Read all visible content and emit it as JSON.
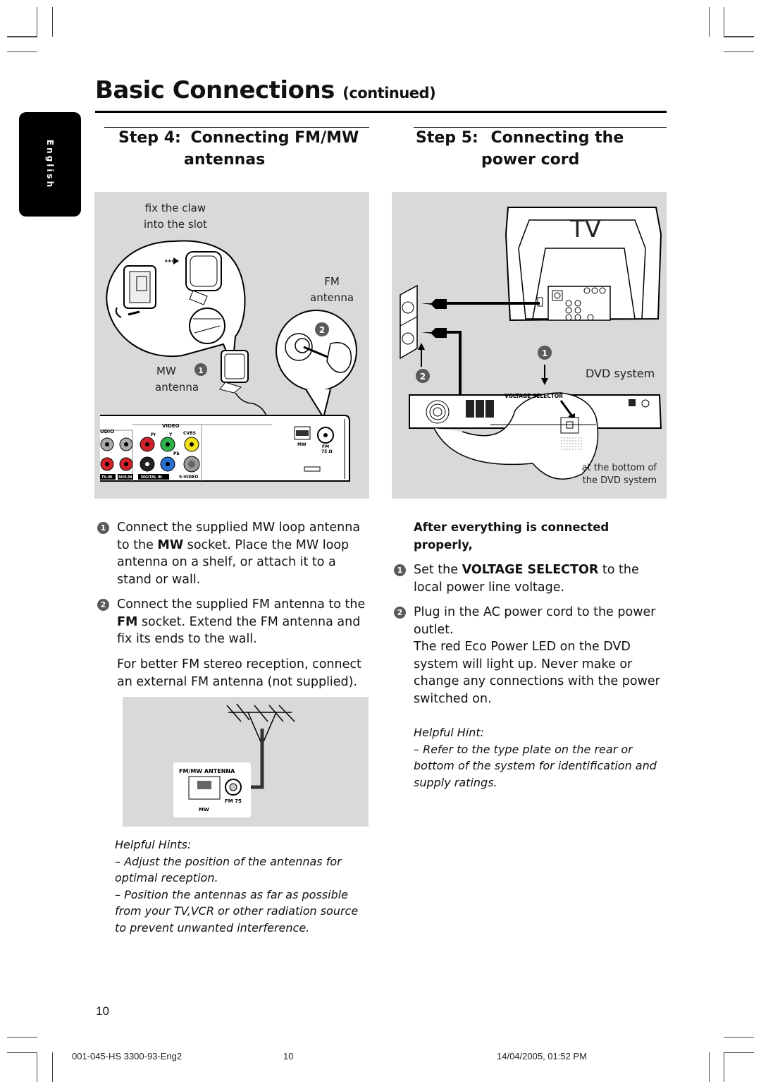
{
  "page": {
    "title": "Basic Connections",
    "title_suffix": "(continued)",
    "language_tab": "English",
    "page_number": "10"
  },
  "step4": {
    "label": "Step 4:",
    "heading_line1": "Connecting FM/MW",
    "heading_line2": "antennas",
    "diagram": {
      "claw_caption_line1": "fix the claw",
      "claw_caption_line2": "into the slot",
      "fm_label": "FM",
      "fm_sub": "antenna",
      "mw_label": "MW",
      "mw_sub": "antenna",
      "badge_1": "1",
      "badge_2": "2",
      "panel_labels": {
        "audio": "UDIO",
        "video": "VIDEO",
        "pr": "Pr",
        "y": "Y",
        "pb": "Pb",
        "cvbs": "CVBS",
        "tv_in": "TV-IN",
        "aux_in": "AUX-IN",
        "digital_in": "DIGITAL IN",
        "s_video": "S-VIDEO",
        "mw": "MW",
        "fm": "FM",
        "fm_ohm": "75 Ω"
      }
    },
    "items": [
      {
        "badge": "1",
        "parts": [
          "Connect the supplied MW loop antenna to the ",
          "MW",
          " socket.  Place the MW loop antenna on a shelf, or attach it to a stand or wall."
        ]
      },
      {
        "badge": "2",
        "parts": [
          "Connect the supplied FM antenna to the ",
          "FM",
          " socket.  Extend the FM antenna and fix its ends to the wall."
        ]
      }
    ],
    "note": "For better FM stereo reception, connect an external FM antenna (not supplied).",
    "ext_diagram": {
      "panel_title": "FM/MW ANTENNA",
      "mw": "MW",
      "fm": "FM  75"
    },
    "hints_title": "Helpful Hints:",
    "hints": [
      "–  Adjust the position of the antennas for optimal reception.",
      "–  Position the antennas as far as possible from your TV,VCR or other radiation source to prevent unwanted interference."
    ]
  },
  "step5": {
    "label": "Step 5:",
    "heading_line1": "Connecting the",
    "heading_line2": "power cord",
    "diagram": {
      "tv_label": "TV",
      "dvd_label": "DVD system",
      "voltage_selector": "VOLTAGE SELECTOR",
      "bottom_caption_line1": "at the bottom of",
      "bottom_caption_line2": "the DVD system",
      "badge_1": "1",
      "badge_2": "2"
    },
    "subheading": "After everything is connected properly,",
    "items": [
      {
        "badge": "1",
        "parts": [
          "Set the ",
          "VOLTAGE SELECTOR",
          " to the local power line voltage."
        ]
      },
      {
        "badge": "2",
        "parts": [
          "Plug in the AC power cord to the power outlet.",
          "",
          ""
        ],
        "extra": "The red Eco Power LED on the DVD system will light up. Never make or change any connections with the power switched on."
      }
    ],
    "hint_title": "Helpful Hint:",
    "hint": "–  Refer to the type plate on the rear or bottom of the system for identification and supply ratings."
  },
  "footer": {
    "doc_id": "001-045-HS 3300-93-Eng2",
    "page": "10",
    "timestamp": "14/04/2005, 01:52 PM"
  },
  "colors": {
    "panel_gray": "#d9d9d9",
    "badge_gray": "#5a5a5a",
    "jack_red": "#d0222a",
    "jack_green": "#2fb34a",
    "jack_blue": "#2a6fd0",
    "jack_yellow": "#f1e21b"
  }
}
